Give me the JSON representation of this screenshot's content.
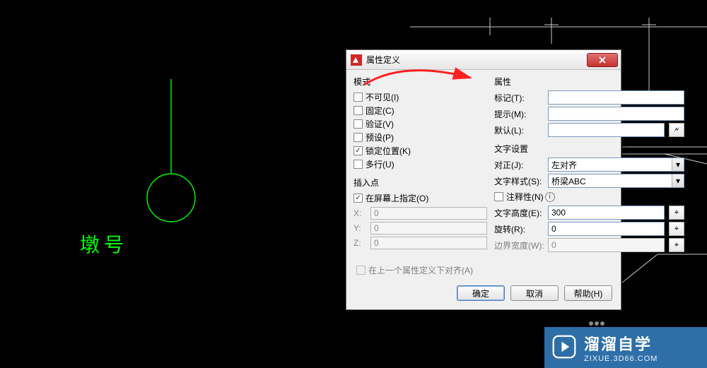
{
  "canvas": {
    "label_text": "墩号"
  },
  "dialog": {
    "title": "属性定义",
    "mode": {
      "group_title": "模式",
      "invisible": "不可见(I)",
      "constant": "固定(C)",
      "verify": "验证(V)",
      "preset": "预设(P)",
      "lock_position": "锁定位置(K)",
      "multiline": "多行(U)"
    },
    "insertion": {
      "group_title": "插入点",
      "specify_on_screen": "在屏幕上指定(O)",
      "x_label": "X:",
      "y_label": "Y:",
      "z_label": "Z:",
      "x_value": "0",
      "y_value": "0",
      "z_value": "0"
    },
    "attribute": {
      "group_title": "属性",
      "tag_label": "标记(T):",
      "prompt_label": "提示(M):",
      "default_label": "默认(L):",
      "tag_value": "",
      "prompt_value": "",
      "default_value": ""
    },
    "text": {
      "group_title": "文字设置",
      "justify_label": "对正(J):",
      "justify_value": "左对齐",
      "style_label": "文字样式(S):",
      "style_value": "桥梁ABC",
      "annotative_label": "注释性(N)",
      "height_label": "文字高度(E):",
      "height_value": "300",
      "rotation_label": "旋转(R):",
      "rotation_value": "0",
      "boundary_label": "边界宽度(W):",
      "boundary_value": "0"
    },
    "align_prev": "在上一个属性定义下对齐(A)",
    "buttons": {
      "ok": "确定",
      "cancel": "取消",
      "help": "帮助(H)"
    }
  },
  "watermark": {
    "brand": "溜溜自学",
    "sub": "ZIXUE.3D66.COM"
  }
}
